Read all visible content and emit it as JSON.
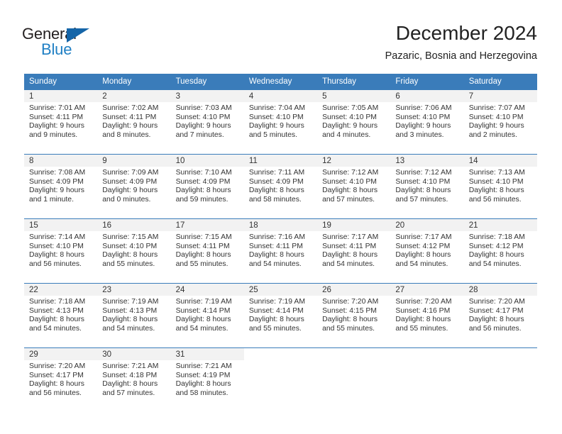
{
  "brand": {
    "name_part1": "General",
    "name_part2": "Blue",
    "accent_color": "#1f7fc4",
    "triangle_color": "#1565a8"
  },
  "header": {
    "month_title": "December 2024",
    "location": "Pazaric, Bosnia and Herzegovina"
  },
  "calendar": {
    "header_color": "#3a7cba",
    "weekday_headers": [
      "Sunday",
      "Monday",
      "Tuesday",
      "Wednesday",
      "Thursday",
      "Friday",
      "Saturday"
    ],
    "weeks": [
      [
        {
          "day": "1",
          "sunrise": "Sunrise: 7:01 AM",
          "sunset": "Sunset: 4:11 PM",
          "daylight_line1": "Daylight: 9 hours",
          "daylight_line2": "and 9 minutes."
        },
        {
          "day": "2",
          "sunrise": "Sunrise: 7:02 AM",
          "sunset": "Sunset: 4:11 PM",
          "daylight_line1": "Daylight: 9 hours",
          "daylight_line2": "and 8 minutes."
        },
        {
          "day": "3",
          "sunrise": "Sunrise: 7:03 AM",
          "sunset": "Sunset: 4:10 PM",
          "daylight_line1": "Daylight: 9 hours",
          "daylight_line2": "and 7 minutes."
        },
        {
          "day": "4",
          "sunrise": "Sunrise: 7:04 AM",
          "sunset": "Sunset: 4:10 PM",
          "daylight_line1": "Daylight: 9 hours",
          "daylight_line2": "and 5 minutes."
        },
        {
          "day": "5",
          "sunrise": "Sunrise: 7:05 AM",
          "sunset": "Sunset: 4:10 PM",
          "daylight_line1": "Daylight: 9 hours",
          "daylight_line2": "and 4 minutes."
        },
        {
          "day": "6",
          "sunrise": "Sunrise: 7:06 AM",
          "sunset": "Sunset: 4:10 PM",
          "daylight_line1": "Daylight: 9 hours",
          "daylight_line2": "and 3 minutes."
        },
        {
          "day": "7",
          "sunrise": "Sunrise: 7:07 AM",
          "sunset": "Sunset: 4:10 PM",
          "daylight_line1": "Daylight: 9 hours",
          "daylight_line2": "and 2 minutes."
        }
      ],
      [
        {
          "day": "8",
          "sunrise": "Sunrise: 7:08 AM",
          "sunset": "Sunset: 4:09 PM",
          "daylight_line1": "Daylight: 9 hours",
          "daylight_line2": "and 1 minute."
        },
        {
          "day": "9",
          "sunrise": "Sunrise: 7:09 AM",
          "sunset": "Sunset: 4:09 PM",
          "daylight_line1": "Daylight: 9 hours",
          "daylight_line2": "and 0 minutes."
        },
        {
          "day": "10",
          "sunrise": "Sunrise: 7:10 AM",
          "sunset": "Sunset: 4:09 PM",
          "daylight_line1": "Daylight: 8 hours",
          "daylight_line2": "and 59 minutes."
        },
        {
          "day": "11",
          "sunrise": "Sunrise: 7:11 AM",
          "sunset": "Sunset: 4:09 PM",
          "daylight_line1": "Daylight: 8 hours",
          "daylight_line2": "and 58 minutes."
        },
        {
          "day": "12",
          "sunrise": "Sunrise: 7:12 AM",
          "sunset": "Sunset: 4:10 PM",
          "daylight_line1": "Daylight: 8 hours",
          "daylight_line2": "and 57 minutes."
        },
        {
          "day": "13",
          "sunrise": "Sunrise: 7:12 AM",
          "sunset": "Sunset: 4:10 PM",
          "daylight_line1": "Daylight: 8 hours",
          "daylight_line2": "and 57 minutes."
        },
        {
          "day": "14",
          "sunrise": "Sunrise: 7:13 AM",
          "sunset": "Sunset: 4:10 PM",
          "daylight_line1": "Daylight: 8 hours",
          "daylight_line2": "and 56 minutes."
        }
      ],
      [
        {
          "day": "15",
          "sunrise": "Sunrise: 7:14 AM",
          "sunset": "Sunset: 4:10 PM",
          "daylight_line1": "Daylight: 8 hours",
          "daylight_line2": "and 56 minutes."
        },
        {
          "day": "16",
          "sunrise": "Sunrise: 7:15 AM",
          "sunset": "Sunset: 4:10 PM",
          "daylight_line1": "Daylight: 8 hours",
          "daylight_line2": "and 55 minutes."
        },
        {
          "day": "17",
          "sunrise": "Sunrise: 7:15 AM",
          "sunset": "Sunset: 4:11 PM",
          "daylight_line1": "Daylight: 8 hours",
          "daylight_line2": "and 55 minutes."
        },
        {
          "day": "18",
          "sunrise": "Sunrise: 7:16 AM",
          "sunset": "Sunset: 4:11 PM",
          "daylight_line1": "Daylight: 8 hours",
          "daylight_line2": "and 54 minutes."
        },
        {
          "day": "19",
          "sunrise": "Sunrise: 7:17 AM",
          "sunset": "Sunset: 4:11 PM",
          "daylight_line1": "Daylight: 8 hours",
          "daylight_line2": "and 54 minutes."
        },
        {
          "day": "20",
          "sunrise": "Sunrise: 7:17 AM",
          "sunset": "Sunset: 4:12 PM",
          "daylight_line1": "Daylight: 8 hours",
          "daylight_line2": "and 54 minutes."
        },
        {
          "day": "21",
          "sunrise": "Sunrise: 7:18 AM",
          "sunset": "Sunset: 4:12 PM",
          "daylight_line1": "Daylight: 8 hours",
          "daylight_line2": "and 54 minutes."
        }
      ],
      [
        {
          "day": "22",
          "sunrise": "Sunrise: 7:18 AM",
          "sunset": "Sunset: 4:13 PM",
          "daylight_line1": "Daylight: 8 hours",
          "daylight_line2": "and 54 minutes."
        },
        {
          "day": "23",
          "sunrise": "Sunrise: 7:19 AM",
          "sunset": "Sunset: 4:13 PM",
          "daylight_line1": "Daylight: 8 hours",
          "daylight_line2": "and 54 minutes."
        },
        {
          "day": "24",
          "sunrise": "Sunrise: 7:19 AM",
          "sunset": "Sunset: 4:14 PM",
          "daylight_line1": "Daylight: 8 hours",
          "daylight_line2": "and 54 minutes."
        },
        {
          "day": "25",
          "sunrise": "Sunrise: 7:19 AM",
          "sunset": "Sunset: 4:14 PM",
          "daylight_line1": "Daylight: 8 hours",
          "daylight_line2": "and 55 minutes."
        },
        {
          "day": "26",
          "sunrise": "Sunrise: 7:20 AM",
          "sunset": "Sunset: 4:15 PM",
          "daylight_line1": "Daylight: 8 hours",
          "daylight_line2": "and 55 minutes."
        },
        {
          "day": "27",
          "sunrise": "Sunrise: 7:20 AM",
          "sunset": "Sunset: 4:16 PM",
          "daylight_line1": "Daylight: 8 hours",
          "daylight_line2": "and 55 minutes."
        },
        {
          "day": "28",
          "sunrise": "Sunrise: 7:20 AM",
          "sunset": "Sunset: 4:17 PM",
          "daylight_line1": "Daylight: 8 hours",
          "daylight_line2": "and 56 minutes."
        }
      ],
      [
        {
          "day": "29",
          "sunrise": "Sunrise: 7:20 AM",
          "sunset": "Sunset: 4:17 PM",
          "daylight_line1": "Daylight: 8 hours",
          "daylight_line2": "and 56 minutes."
        },
        {
          "day": "30",
          "sunrise": "Sunrise: 7:21 AM",
          "sunset": "Sunset: 4:18 PM",
          "daylight_line1": "Daylight: 8 hours",
          "daylight_line2": "and 57 minutes."
        },
        {
          "day": "31",
          "sunrise": "Sunrise: 7:21 AM",
          "sunset": "Sunset: 4:19 PM",
          "daylight_line1": "Daylight: 8 hours",
          "daylight_line2": "and 58 minutes."
        },
        {
          "day": "",
          "sunrise": "",
          "sunset": "",
          "daylight_line1": "",
          "daylight_line2": ""
        },
        {
          "day": "",
          "sunrise": "",
          "sunset": "",
          "daylight_line1": "",
          "daylight_line2": ""
        },
        {
          "day": "",
          "sunrise": "",
          "sunset": "",
          "daylight_line1": "",
          "daylight_line2": ""
        },
        {
          "day": "",
          "sunrise": "",
          "sunset": "",
          "daylight_line1": "",
          "daylight_line2": ""
        }
      ]
    ]
  }
}
